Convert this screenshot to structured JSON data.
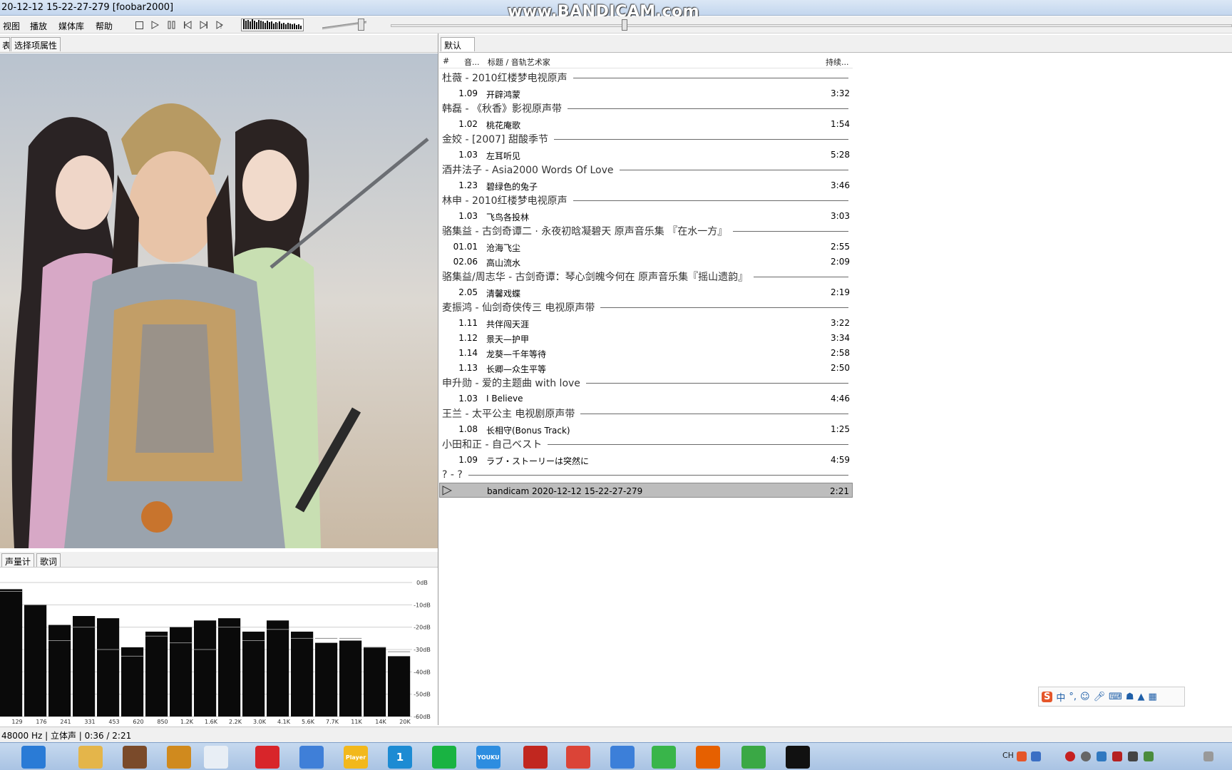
{
  "window": {
    "title": "20-12-12 15-22-27-279  [foobar2000]",
    "watermark": "www.BANDICAM.com"
  },
  "menu": [
    "视图",
    "播放",
    "媒体库",
    "帮助"
  ],
  "left_tabs": [
    "表",
    "选择项属性"
  ],
  "spectrum_tabs": [
    "声量计",
    "歌词"
  ],
  "spectrum": {
    "db_labels": [
      "0dB",
      "-10dB",
      "-20dB",
      "-30dB",
      "-40dB",
      "-50dB",
      "-60dB"
    ],
    "freq_labels": [
      "129",
      "176",
      "241",
      "331",
      "453",
      "620",
      "850",
      "1.2K",
      "1.6K",
      "2.2K",
      "3.0K",
      "4.1K",
      "5.6K",
      "7.7K",
      "11K",
      "14K",
      "20K"
    ],
    "levels_db": [
      -4,
      -3,
      -10,
      -10,
      -26,
      -19,
      -20,
      -15,
      -30,
      -16,
      -33,
      -29,
      -24,
      -22,
      -27,
      -20,
      -30,
      -17,
      -20,
      -16,
      -26,
      -22,
      -21,
      -17,
      -25,
      -22,
      -25,
      -27,
      -25,
      -26,
      -29,
      -29,
      -31,
      -33
    ]
  },
  "status": "48000 Hz | 立体声 | 0:36 / 2:21",
  "playlist": {
    "tab": "默认",
    "columns": {
      "idx": "#",
      "tracknum": "音...",
      "title": "标题 / 音轨艺术家",
      "duration": "持续..."
    },
    "groups": [
      {
        "header": "杜薇 - 2010红楼梦电视原声",
        "tracks": [
          {
            "num": "1.09",
            "title": "开辟鸿蒙",
            "duration": "3:32"
          }
        ]
      },
      {
        "header": "韩磊 - 《秋香》影视原声带",
        "tracks": [
          {
            "num": "1.02",
            "title": "桃花庵歌",
            "duration": "1:54"
          }
        ]
      },
      {
        "header": "金姣 - [2007] 甜酸季节",
        "tracks": [
          {
            "num": "1.03",
            "title": "左耳听见",
            "duration": "5:28"
          }
        ]
      },
      {
        "header": "酒井法子 - Asia2000 Words Of Love",
        "tracks": [
          {
            "num": "1.23",
            "title": "碧绿色的兔子",
            "duration": "3:46"
          }
        ]
      },
      {
        "header": "林申 - 2010红楼梦电视原声",
        "tracks": [
          {
            "num": "1.03",
            "title": "飞鸟各投林",
            "duration": "3:03"
          }
        ]
      },
      {
        "header": "骆集益 - 古剑奇谭二 · 永夜初晗凝碧天 原声音乐集 『在水一方』",
        "tracks": [
          {
            "num": "01.01",
            "title": "沧海飞尘",
            "duration": "2:55"
          },
          {
            "num": "02.06",
            "title": "高山流水",
            "duration": "2:09"
          }
        ]
      },
      {
        "header": "骆集益/周志华 - 古剑奇谭：琴心剑魄今何在 原声音乐集『摇山遗韵』",
        "tracks": [
          {
            "num": "2.05",
            "title": "清馨戏蝶",
            "duration": "2:19"
          }
        ]
      },
      {
        "header": "麦振鸿 - 仙剑奇侠传三 电视原声带",
        "tracks": [
          {
            "num": "1.11",
            "title": "共伴闯天涯",
            "duration": "3:22"
          },
          {
            "num": "1.12",
            "title": "景天—护甲",
            "duration": "3:34"
          },
          {
            "num": "1.14",
            "title": "龙葵—千年等待",
            "duration": "2:58"
          },
          {
            "num": "1.13",
            "title": "长卿—众生平等",
            "duration": "2:50"
          }
        ]
      },
      {
        "header": "申升勋 - 爱的主题曲 with love",
        "tracks": [
          {
            "num": "1.03",
            "title": "I Believe",
            "duration": "4:46"
          }
        ]
      },
      {
        "header": "王兰 - 太平公主 电视剧原声带",
        "tracks": [
          {
            "num": "1.08",
            "title": "长相守(Bonus Track)",
            "duration": "1:25"
          }
        ]
      },
      {
        "header": "小田和正 - 自己ベスト",
        "tracks": [
          {
            "num": "1.09",
            "title": "ラブ・ストーリーは突然に",
            "duration": "4:59"
          }
        ]
      },
      {
        "header": "? - ?",
        "tracks": [
          {
            "num": "",
            "title": "bandicam 2020-12-12 15-22-27-279",
            "duration": "2:21",
            "playing": true
          }
        ]
      }
    ]
  },
  "ime": {
    "logo": "S",
    "mode": "中"
  },
  "taskbar": {
    "apps": [
      {
        "icon": "search-icon",
        "color": "#2a7bd6"
      },
      {
        "icon": "folder-icon",
        "color": "#e4b54a"
      },
      {
        "icon": "video-editor-icon",
        "color": "#7a4a2a"
      },
      {
        "icon": "headphones-icon",
        "color": "#d08a1e"
      },
      {
        "icon": "foobar-icon",
        "color": "#e8eef5"
      },
      {
        "icon": "netease-music-icon",
        "color": "#d8252a"
      },
      {
        "icon": "media-player-icon",
        "color": "#3f7fd8"
      },
      {
        "icon": "potplayer-icon",
        "color": "#f2b81c",
        "label": "Player"
      },
      {
        "icon": "app-1-icon",
        "color": "#1d8bd3",
        "label": "1"
      },
      {
        "icon": "iqiyi-icon",
        "color": "#19b342"
      },
      {
        "icon": "youku-icon",
        "color": "#2d8de0",
        "label": "YOUKU"
      },
      {
        "icon": "flash-icon",
        "color": "#c1271f"
      },
      {
        "icon": "chrome-icon",
        "color": "#db4437"
      },
      {
        "icon": "bird-app-icon",
        "color": "#3c7fd9"
      },
      {
        "icon": "play-store-icon",
        "color": "#39b54a"
      },
      {
        "icon": "firefox-icon",
        "color": "#e66000"
      },
      {
        "icon": "360-browser-icon",
        "color": "#3aa845"
      },
      {
        "icon": "bandicam-icon",
        "color": "#111111"
      }
    ],
    "tray_lang": "CH"
  }
}
